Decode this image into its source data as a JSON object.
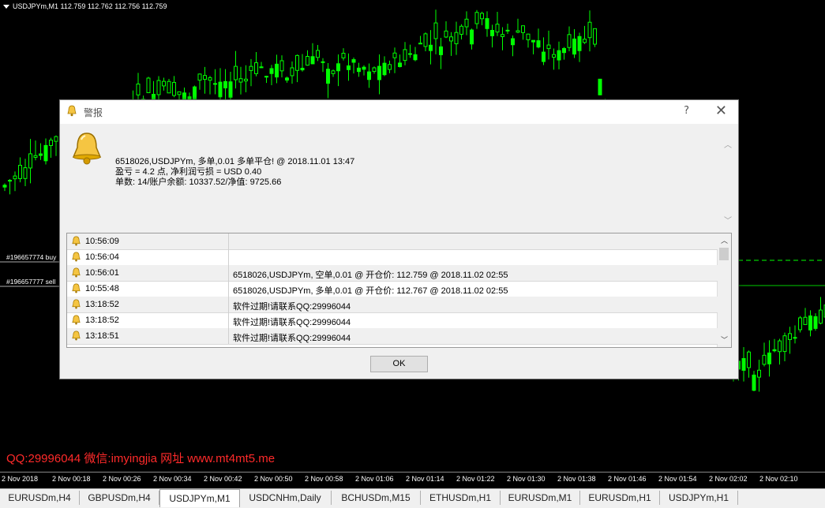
{
  "chart": {
    "header": "USDJPYm,M1  112.759 112.762 112.756 112.759",
    "order_labels": [
      "#196657774 buy",
      "#196657777 sell"
    ],
    "watermark": "QQ:29996044 微信:imyingjia 网址 www.mt4mt5.me",
    "time_ticks": [
      "2 Nov 2018",
      "2 Nov 00:18",
      "2 Nov 00:26",
      "2 Nov 00:34",
      "2 Nov 00:42",
      "2 Nov 00:50",
      "2 Nov 00:58",
      "2 Nov 01:06",
      "2 Nov 01:14",
      "2 Nov 01:22",
      "2 Nov 01:30",
      "2 Nov 01:38",
      "2 Nov 01:46",
      "2 Nov 01:54",
      "2 Nov 02:02",
      "2 Nov 02:10"
    ],
    "colors": {
      "bull": "#00ff00",
      "bear": "#00ff00",
      "background": "#000000"
    }
  },
  "tabs": [
    "EURUSDm,H4",
    "GBPUSDm,H4",
    "USDJPYm,M1",
    "USDCNHm,Daily",
    "BCHUSDm,M15",
    "ETHUSDm,H1",
    "EURUSDm,M1",
    "EURUSDm,H1",
    "USDJPYm,H1"
  ],
  "active_tab": "USDJPYm,M1",
  "dialog": {
    "title": "警报",
    "help": "?",
    "close": "✕",
    "message_line1": "6518026,USDJPYm, 多单,0.01 多单平仓!   @ 2018.11.01 13:47",
    "message_line2": "盈亏 = 4.2 点, 净利润亏损 = USD 0.40",
    "message_line3": "单数: 14/账户余额: 10337.52/净值:   9725.66",
    "alerts": [
      {
        "time": "10:56:09",
        "message": ""
      },
      {
        "time": "10:56:04",
        "message": ""
      },
      {
        "time": "10:56:01",
        "message": "6518026,USDJPYm, 空单,0.01 @ 开仓价:   112.759 @ 2018.11.02 02:55"
      },
      {
        "time": "10:55:48",
        "message": "6518026,USDJPYm, 多单,0.01 @ 开仓价:   112.767 @ 2018.11.02 02:55"
      },
      {
        "time": "13:18:52",
        "message": "软件过期!请联系QQ:29996044"
      },
      {
        "time": "13:18:52",
        "message": "软件过期!请联系QQ:29996044"
      },
      {
        "time": "13:18:51",
        "message": "软件过期!请联系QQ:29996044"
      }
    ],
    "ok_label": "OK"
  }
}
